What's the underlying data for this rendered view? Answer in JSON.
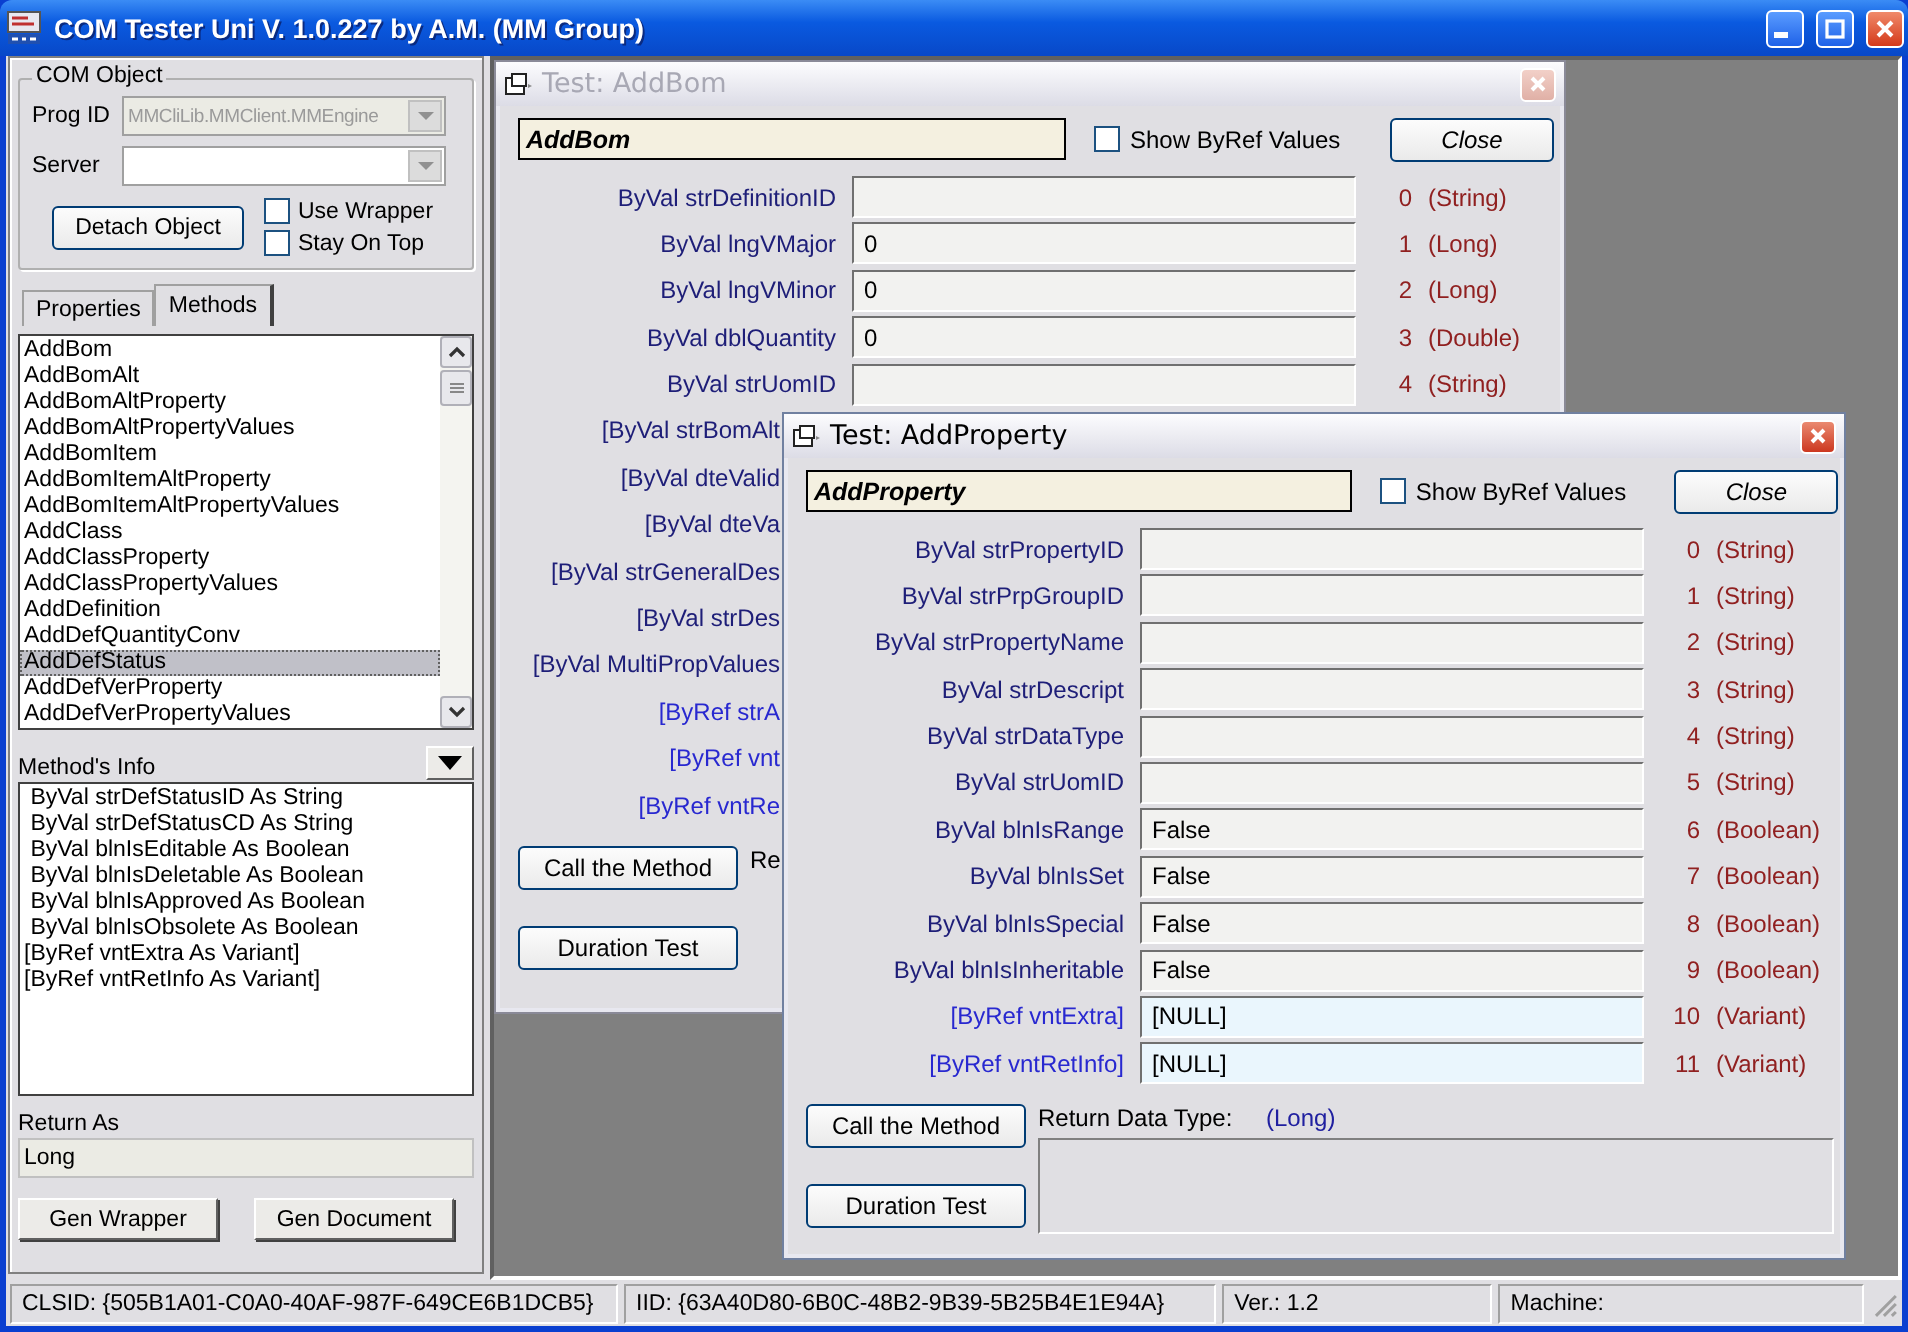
{
  "window": {
    "title": "COM Tester Uni V. 1.0.227 by A.M. (MM Group)"
  },
  "com_object": {
    "title": "COM Object",
    "prog_id": {
      "label": "Prog ID",
      "value": "MMCliLib.MMClient.MMEngine",
      "disabled": true
    },
    "server": {
      "label": "Server",
      "disabled": false
    },
    "detach_button": "Detach Object",
    "options": [
      {
        "label": "Use Wrapper",
        "checked": false
      },
      {
        "label": "Stay On Top",
        "checked": false
      }
    ]
  },
  "tabs": [
    {
      "label": "Properties",
      "selected": false
    },
    {
      "label": "Methods",
      "selected": true
    }
  ],
  "methods": [
    {
      "label": "AddBom",
      "selected": false
    },
    {
      "label": "AddBomAlt",
      "selected": false
    },
    {
      "label": "AddBomAltProperty",
      "selected": false
    },
    {
      "label": "AddBomAltPropertyValues",
      "selected": false
    },
    {
      "label": "AddBomItem",
      "selected": false
    },
    {
      "label": "AddBomItemAltProperty",
      "selected": false
    },
    {
      "label": "AddBomItemAltPropertyValues",
      "selected": false
    },
    {
      "label": "AddClass",
      "selected": false
    },
    {
      "label": "AddClassProperty",
      "selected": false
    },
    {
      "label": "AddClassPropertyValues",
      "selected": false
    },
    {
      "label": "AddDefinition",
      "selected": false
    },
    {
      "label": "AddDefQuantityConv",
      "selected": false
    },
    {
      "label": "AddDefStatus",
      "selected": true
    },
    {
      "label": "AddDefVerProperty",
      "selected": false
    },
    {
      "label": "AddDefVerPropertyValues",
      "selected": false
    }
  ],
  "method_info": {
    "title": "Method's Info",
    "lines": [
      " ByVal strDefStatusID As String",
      " ByVal strDefStatusCD As String",
      " ByVal blnIsEditable As Boolean",
      " ByVal blnIsDeletable As Boolean",
      " ByVal blnIsApproved As Boolean",
      " ByVal blnIsObsolete As Boolean",
      "[ByRef vntExtra As Variant]",
      "[ByRef vntRetInfo As Variant]"
    ]
  },
  "return_as": {
    "label": "Return As",
    "value": "Long"
  },
  "buttons": [
    "Gen Wrapper",
    "Gen Document"
  ],
  "test_windows": [
    {
      "title": "Test: AddBom",
      "active": false,
      "method": "AddBom",
      "show_byref": {
        "label": "Show ByRef Values",
        "checked": false
      },
      "close": "Close",
      "params": [
        {
          "label": "ByVal strDefinitionID",
          "byref": false,
          "index": "0",
          "type": "(String)"
        },
        {
          "label": "ByVal lngVMajor",
          "byref": false,
          "value": "0",
          "index": "1",
          "type": "(Long)"
        },
        {
          "label": "ByVal lngVMinor",
          "byref": false,
          "value": "0",
          "index": "2",
          "type": "(Long)"
        },
        {
          "label": "ByVal dblQuantity",
          "byref": false,
          "value": "0",
          "index": "3",
          "type": "(Double)"
        },
        {
          "label": "ByVal strUomID",
          "byref": false,
          "index": "4",
          "type": "(String)"
        },
        {
          "label": "[ByVal strBomAlt",
          "byref": false
        },
        {
          "label": "[ByVal dteValid",
          "byref": false
        },
        {
          "label": "[ByVal dteVa",
          "byref": false
        },
        {
          "label": "[ByVal strGeneralDes",
          "byref": false
        },
        {
          "label": "[ByVal strDes",
          "byref": false
        },
        {
          "label": "[ByVal MultiPropValues",
          "byref": false
        },
        {
          "label": "[ByRef strA",
          "byref": true
        },
        {
          "label": "[ByRef vnt",
          "byref": true
        },
        {
          "label": "[ByRef vntRe",
          "byref": true
        }
      ],
      "call_button": "Call the Method",
      "duration_button": "Duration Test",
      "return_label": "Re"
    },
    {
      "title": "Test: AddProperty",
      "active": true,
      "method": "AddProperty",
      "show_byref": {
        "label": "Show ByRef Values",
        "checked": false
      },
      "close": "Close",
      "params": [
        {
          "label": "ByVal strPropertyID",
          "byref": false,
          "index": "0",
          "type": "(String)"
        },
        {
          "label": "ByVal strPrpGroupID",
          "byref": false,
          "index": "1",
          "type": "(String)"
        },
        {
          "label": "ByVal strPropertyName",
          "byref": false,
          "index": "2",
          "type": "(String)"
        },
        {
          "label": "ByVal strDescript",
          "byref": false,
          "index": "3",
          "type": "(String)"
        },
        {
          "label": "ByVal strDataType",
          "byref": false,
          "index": "4",
          "type": "(String)"
        },
        {
          "label": "ByVal strUomID",
          "byref": false,
          "index": "5",
          "type": "(String)"
        },
        {
          "label": "ByVal blnIsRange",
          "byref": false,
          "value": "False",
          "index": "6",
          "type": "(Boolean)"
        },
        {
          "label": "ByVal blnIsSet",
          "byref": false,
          "value": "False",
          "index": "7",
          "type": "(Boolean)"
        },
        {
          "label": "ByVal blnIsSpecial",
          "byref": false,
          "value": "False",
          "index": "8",
          "type": "(Boolean)"
        },
        {
          "label": "ByVal blnIsInheritable",
          "byref": false,
          "value": "False",
          "index": "9",
          "type": "(Boolean)"
        },
        {
          "label": "[ByRef vntExtra]",
          "byref": true,
          "value": "[NULL]",
          "index": "10",
          "type": "(Variant)"
        },
        {
          "label": "[ByRef vntRetInfo]",
          "byref": true,
          "value": "[NULL]",
          "index": "11",
          "type": "(Variant)"
        }
      ],
      "call_button": "Call the Method",
      "duration_button": "Duration Test",
      "return_label": "Return Data Type:",
      "return_type": "(Long)"
    }
  ],
  "status_bar": [
    "CLSID: {505B1A01-C0A0-40AF-987F-649CE6B1DCB5}",
    "IID: {63A40D80-6B0C-48B2-9B39-5B25B4E1E94A}",
    "Ver.: 1.2",
    "Machine:"
  ]
}
